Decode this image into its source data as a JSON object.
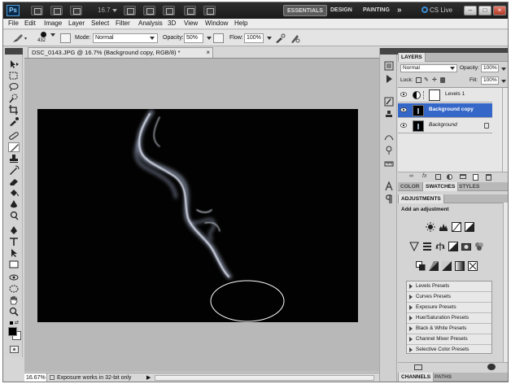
{
  "appbar": {
    "logo": "Ps",
    "zoom": "16.7",
    "workspaces": [
      "ESSENTIALS",
      "DESIGN",
      "PAINTING"
    ],
    "more": "»",
    "cs_live": "CS Live"
  },
  "menu": [
    "File",
    "Edit",
    "Image",
    "Layer",
    "Select",
    "Filter",
    "Analysis",
    "3D",
    "View",
    "Window",
    "Help"
  ],
  "options": {
    "brush_size": "432",
    "mode_label": "Mode:",
    "mode_value": "Normal",
    "opacity_label": "Opacity:",
    "opacity_value": "50%",
    "flow_label": "Flow:",
    "flow_value": "100%"
  },
  "document": {
    "tab_title": "DSC_0143.JPG @ 16.7% (Background copy, RGB/8) *",
    "close": "×",
    "ellipse_selection": true
  },
  "status": {
    "zoom": "16.67%",
    "message": "Exposure works in 32-bit only",
    "arrow": "▶"
  },
  "layers_panel": {
    "tab": "LAYERS",
    "blend_mode": "Normal",
    "opacity_label": "Opacity:",
    "opacity_value": "100%",
    "lock_label": "Lock:",
    "fill_label": "Fill:",
    "fill_value": "100%",
    "layers": [
      {
        "name": "Levels 1",
        "selected": false
      },
      {
        "name": "Background copy",
        "selected": true
      },
      {
        "name": "Background",
        "selected": false
      }
    ]
  },
  "swatch_tabs": [
    "COLOR",
    "SWATCHES",
    "STYLES"
  ],
  "adjustments": {
    "tab": "ADJUSTMENTS",
    "title": "Add an adjustment",
    "presets": [
      "Levels Presets",
      "Curves Presets",
      "Exposure Presets",
      "Hue/Saturation Presets",
      "Black & White Presets",
      "Channel Mixer Presets",
      "Selective Color Presets"
    ]
  },
  "bottom_tabs": [
    "CHANNELS",
    "PATHS"
  ],
  "icons": {
    "brush": "brush-icon",
    "eye": "eye-icon",
    "lock": "lock-icon"
  }
}
